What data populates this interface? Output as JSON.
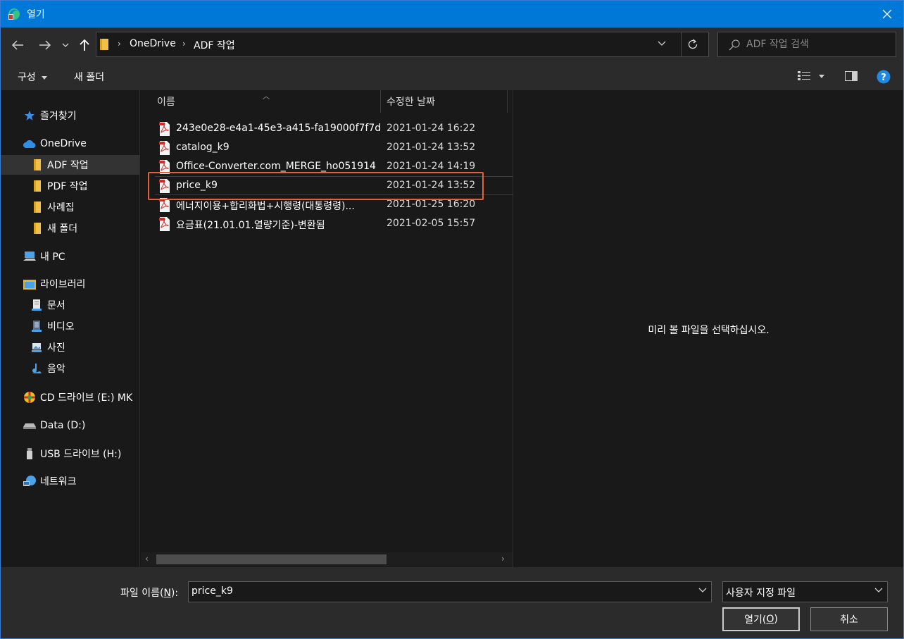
{
  "window": {
    "title": "열기"
  },
  "navigation": {
    "breadcrumbs": [
      "OneDrive",
      "ADF 작업"
    ],
    "search_placeholder": "ADF 작업 검색"
  },
  "toolbar": {
    "organize_label": "구성",
    "new_folder_label": "새 폴더"
  },
  "sidebar": {
    "items": [
      {
        "label": "즐겨찾기",
        "icon": "star-icon"
      },
      {
        "label": "OneDrive",
        "icon": "cloud-icon"
      },
      {
        "label": "ADF 작업",
        "icon": "folder-icon",
        "selected": true
      },
      {
        "label": "PDF 작업",
        "icon": "folder-icon"
      },
      {
        "label": "사례집",
        "icon": "folder-icon"
      },
      {
        "label": "새 폴더",
        "icon": "folder-icon"
      },
      {
        "label": "내 PC",
        "icon": "computer-icon"
      },
      {
        "label": "라이브러리",
        "icon": "library-icon"
      },
      {
        "label": "문서",
        "icon": "documents-icon"
      },
      {
        "label": "비디오",
        "icon": "video-icon"
      },
      {
        "label": "사진",
        "icon": "pictures-icon"
      },
      {
        "label": "음악",
        "icon": "music-icon"
      },
      {
        "label": "CD 드라이브 (E:) MK",
        "icon": "cd-drive-icon"
      },
      {
        "label": "Data (D:)",
        "icon": "disk-drive-icon"
      },
      {
        "label": "USB 드라이브 (H:)",
        "icon": "usb-drive-icon"
      },
      {
        "label": "네트워크",
        "icon": "network-icon"
      }
    ]
  },
  "file_list": {
    "columns": {
      "name": "이름",
      "date": "수정한 날짜"
    },
    "files": [
      {
        "name": "243e0e28-e4a1-45e3-a415-fa19000f7f7d...",
        "date": "2021-01-24 16:22"
      },
      {
        "name": "catalog_k9",
        "date": "2021-01-24 13:52"
      },
      {
        "name": "Office-Converter.com_MERGE_ho051914",
        "date": "2021-01-24 14:19"
      },
      {
        "name": "price_k9",
        "date": "2021-01-24 13:52",
        "selected": true
      },
      {
        "name": "에너지이용+합리화법+시행령(대통령령)...",
        "date": "2021-01-25 16:20"
      },
      {
        "name": "요금표(21.01.01.열량기준)-변환됨",
        "date": "2021-02-05 15:57"
      }
    ]
  },
  "preview": {
    "message": "미리 볼 파일을 선택하십시오."
  },
  "bottom": {
    "filename_label_prefix": "파일 이름(",
    "filename_label_key": "N",
    "filename_label_suffix": "):",
    "filename_value": "price_k9",
    "filetype_value": "사용자 지정 파일",
    "open_label_prefix": "열기(",
    "open_label_key": "O",
    "open_label_suffix": ")",
    "cancel_label": "취소"
  },
  "colors": {
    "titlebar": "#0078d7",
    "highlight": "#e0613a"
  }
}
